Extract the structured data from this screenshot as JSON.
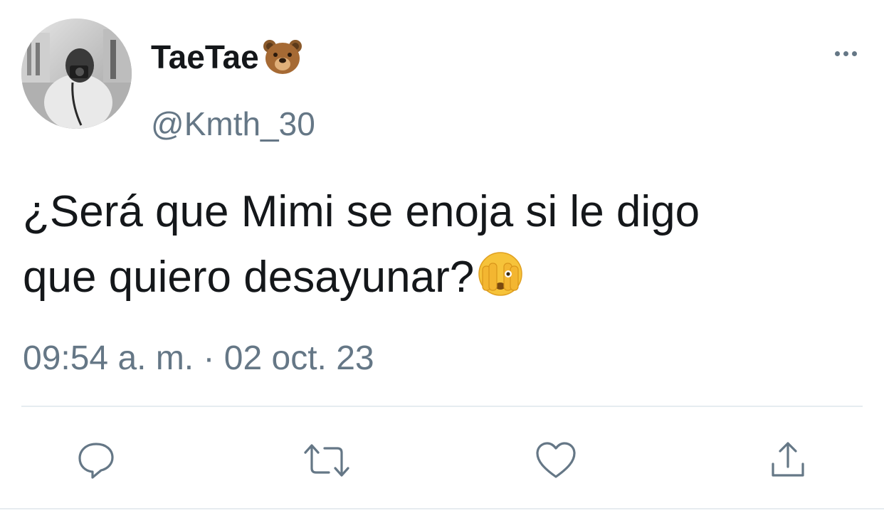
{
  "tweet": {
    "display_name": "TaeTae",
    "display_name_emoji": "bear-face-icon",
    "handle": "@Kmth_30",
    "text_line1": "¿Será que Mimi se enoja si le digo",
    "text_line2": "que quiero desayunar?",
    "text_emoji": "face-with-hands-over-eyes-icon",
    "timestamp": "09:54 a. m. · 02 oct. 23"
  },
  "actions": {
    "reply": "reply-icon",
    "retweet": "retweet-icon",
    "like": "heart-icon",
    "share": "share-icon",
    "more": "more-dots-icon"
  },
  "colors": {
    "text": "#14171a",
    "secondary": "#657786",
    "divider": "#e6ecf0",
    "background": "#ffffff"
  }
}
